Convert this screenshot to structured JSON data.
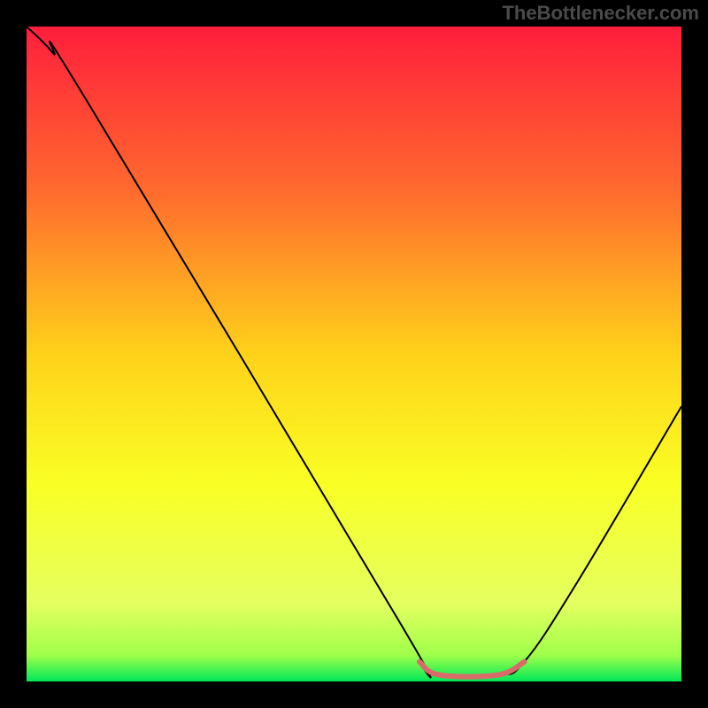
{
  "watermark": "TheBottlenecker.com",
  "chart_data": {
    "type": "line",
    "title": "",
    "xlabel": "",
    "ylabel": "",
    "xlim": [
      0,
      100
    ],
    "ylim": [
      0,
      100
    ],
    "background": {
      "type": "vertical-gradient",
      "stops": [
        {
          "offset": 0,
          "color": "#ff1e3c"
        },
        {
          "offset": 25,
          "color": "#ff6a2e"
        },
        {
          "offset": 50,
          "color": "#ffd21a"
        },
        {
          "offset": 70,
          "color": "#f9ff25"
        },
        {
          "offset": 88,
          "color": "#e5ff60"
        },
        {
          "offset": 96,
          "color": "#a0ff4a"
        },
        {
          "offset": 100,
          "color": "#00e858"
        }
      ]
    },
    "series": [
      {
        "name": "bottleneck-curve",
        "color": "#000000",
        "width": 2,
        "points": [
          {
            "x": 0,
            "y": 100
          },
          {
            "x": 4,
            "y": 96
          },
          {
            "x": 9,
            "y": 89
          },
          {
            "x": 57,
            "y": 9
          },
          {
            "x": 60,
            "y": 3
          },
          {
            "x": 63,
            "y": 1
          },
          {
            "x": 72,
            "y": 1
          },
          {
            "x": 76,
            "y": 3
          },
          {
            "x": 84,
            "y": 15
          },
          {
            "x": 100,
            "y": 42
          }
        ]
      },
      {
        "name": "optimal-range",
        "color": "#d96a6a",
        "width": 6,
        "points": [
          {
            "x": 60,
            "y": 3
          },
          {
            "x": 63,
            "y": 1
          },
          {
            "x": 72,
            "y": 1
          },
          {
            "x": 76,
            "y": 3
          }
        ]
      }
    ]
  }
}
